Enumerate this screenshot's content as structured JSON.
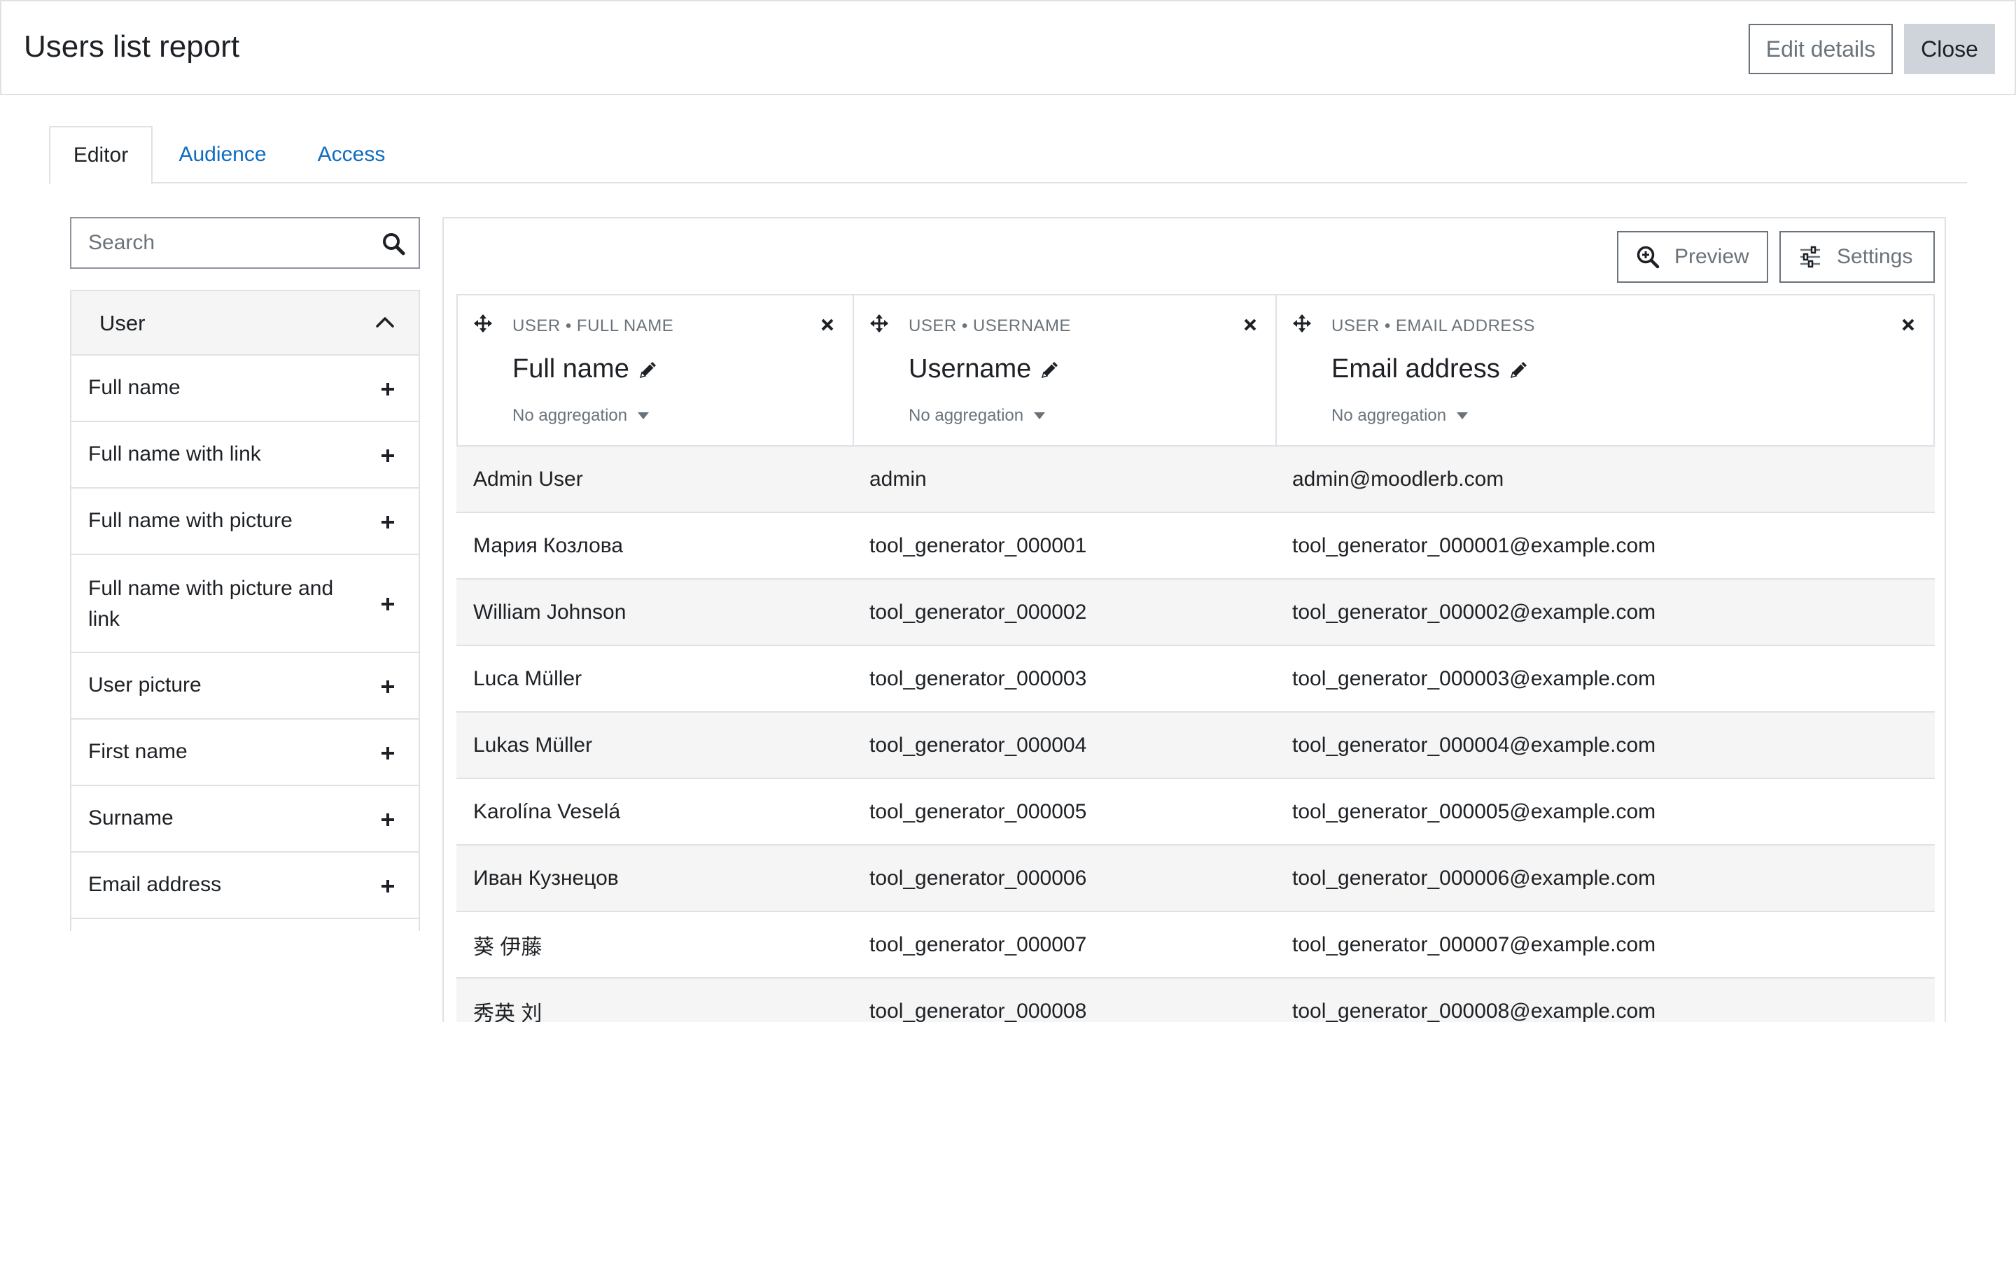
{
  "header": {
    "title": "Users list report",
    "edit_label": "Edit details",
    "close_label": "Close"
  },
  "tabs": [
    {
      "label": "Editor",
      "active": true
    },
    {
      "label": "Audience",
      "active": false
    },
    {
      "label": "Access",
      "active": false
    }
  ],
  "search": {
    "placeholder": "Search",
    "icon": "search-icon"
  },
  "sidebar": {
    "group_label": "User",
    "group_expanded": true,
    "items": [
      {
        "label": "Full name"
      },
      {
        "label": "Full name with link"
      },
      {
        "label": "Full name with picture"
      },
      {
        "label": "Full name with picture and link"
      },
      {
        "label": "User picture"
      },
      {
        "label": "First name"
      },
      {
        "label": "Surname"
      },
      {
        "label": "Email address"
      }
    ]
  },
  "toolbar": {
    "preview_label": "Preview",
    "settings_label": "Settings"
  },
  "columns": [
    {
      "path": "USER • FULL NAME",
      "title": "Full name",
      "aggregation": "No aggregation"
    },
    {
      "path": "USER • USERNAME",
      "title": "Username",
      "aggregation": "No aggregation"
    },
    {
      "path": "USER • EMAIL ADDRESS",
      "title": "Email address",
      "aggregation": "No aggregation"
    }
  ],
  "rows": [
    [
      "Admin User",
      "admin",
      "admin@moodlerb.com"
    ],
    [
      "Мария Козлова",
      "tool_generator_000001",
      "tool_generator_000001@example.com"
    ],
    [
      "William Johnson",
      "tool_generator_000002",
      "tool_generator_000002@example.com"
    ],
    [
      "Luca Müller",
      "tool_generator_000003",
      "tool_generator_000003@example.com"
    ],
    [
      "Lukas Müller",
      "tool_generator_000004",
      "tool_generator_000004@example.com"
    ],
    [
      "Karolína Veselá",
      "tool_generator_000005",
      "tool_generator_000005@example.com"
    ],
    [
      "Иван Кузнецов",
      "tool_generator_000006",
      "tool_generator_000006@example.com"
    ],
    [
      "葵 伊藤",
      "tool_generator_000007",
      "tool_generator_000007@example.com"
    ],
    [
      "秀英 刘",
      "tool_generator_000008",
      "tool_generator_000008@example.com"
    ]
  ],
  "colors": {
    "link": "#0f6cbf",
    "border": "#dee2e6",
    "stripe": "#f5f5f5",
    "muted": "#6a737b"
  }
}
